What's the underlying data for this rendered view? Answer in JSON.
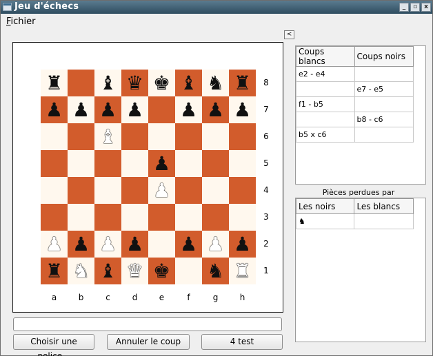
{
  "window": {
    "title": "Jeu d'échecs",
    "controls": [
      "_",
      "▫",
      "x"
    ]
  },
  "menu": {
    "fichier_underline": "F",
    "fichier_rest": "ichier"
  },
  "collapse_button": "<",
  "board": {
    "ranks": [
      "8",
      "7",
      "6",
      "5",
      "4",
      "3",
      "2",
      "1"
    ],
    "files": [
      "a",
      "b",
      "c",
      "d",
      "e",
      "f",
      "g",
      "h"
    ],
    "squares": [
      [
        "bR",
        "",
        "bB",
        "bQ",
        "bK",
        "bB",
        "bN",
        "bR"
      ],
      [
        "bP",
        "bP",
        "bP",
        "bP",
        "",
        "bP",
        "bP",
        "bP"
      ],
      [
        "",
        "",
        "wB",
        "",
        "",
        "",
        "",
        ""
      ],
      [
        "",
        "",
        "",
        "",
        "bP",
        "",
        "",
        ""
      ],
      [
        "",
        "",
        "",
        "",
        "wP",
        "",
        "",
        ""
      ],
      [
        "",
        "",
        "",
        "",
        "",
        "",
        "",
        ""
      ],
      [
        "wP",
        "bP",
        "wP",
        "bP",
        "",
        "bP",
        "wP",
        "bP"
      ],
      [
        "bR",
        "wN",
        "bB",
        "wQ",
        "bK",
        "",
        "bN",
        "wR"
      ]
    ],
    "colors": {
      "light": "#fff8ee",
      "dark": "#d25c2c"
    }
  },
  "input": {
    "value": ""
  },
  "buttons": {
    "font": "Choisir une police...",
    "undo": "Annuler le coup",
    "test": "4 test"
  },
  "moves": {
    "headers": [
      "Coups blancs",
      "Coups noirs"
    ],
    "rows": [
      [
        "e2 - e4",
        ""
      ],
      [
        "",
        "e7 - e5"
      ],
      [
        "f1 - b5",
        ""
      ],
      [
        "",
        "b8 - c6"
      ],
      [
        "b5 x c6",
        ""
      ]
    ]
  },
  "lost": {
    "caption": "Pièces perdues par",
    "headers": [
      "Les noirs",
      "Les blancs"
    ],
    "rows": [
      [
        "♞",
        ""
      ]
    ]
  }
}
